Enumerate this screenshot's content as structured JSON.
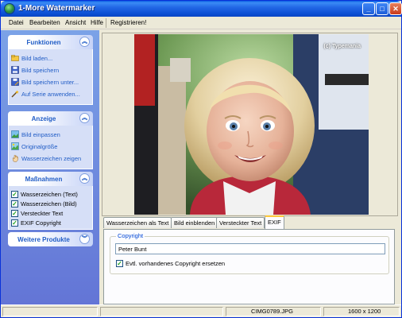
{
  "window": {
    "title": "1-More Watermarker"
  },
  "menu": [
    "Datei",
    "Bearbeiten",
    "Ansicht",
    "Hilfe",
    "Registrieren!"
  ],
  "sidebar": {
    "funktionen": {
      "title": "Funktionen",
      "items": [
        {
          "label": "Bild laden...",
          "icon": "open-folder-icon"
        },
        {
          "label": "Bild speichern",
          "icon": "floppy-disk-icon"
        },
        {
          "label": "Bild speichern unter...",
          "icon": "save-as-icon"
        },
        {
          "label": "Auf Serie anwenden...",
          "icon": "magic-wand-icon"
        }
      ]
    },
    "anzeige": {
      "title": "Anzeige",
      "items": [
        {
          "label": "Bild einpassen",
          "icon": "fit-image-icon"
        },
        {
          "label": "Originalgröße",
          "icon": "original-size-icon"
        },
        {
          "label": "Wasserzeichen zeigen",
          "icon": "hand-icon"
        }
      ]
    },
    "massnahmen": {
      "title": "Maßnahmen",
      "items": [
        {
          "label": "Wasserzeichen (Text)",
          "checked": true
        },
        {
          "label": "Wasserzeichen (Bild)",
          "checked": true
        },
        {
          "label": "Versteckter Text",
          "checked": true
        },
        {
          "label": "EXIF Copyright",
          "checked": true
        }
      ]
    },
    "weitere": {
      "title": "Weitere Produkte"
    }
  },
  "preview": {
    "watermark_text": "(c) Typemania"
  },
  "tabs": [
    "Wasserzeichen als Text",
    "Bild einblenden",
    "Versteckter Text",
    "EXIF"
  ],
  "active_tab": "EXIF",
  "exif": {
    "group_label": "Copyright",
    "copyright_value": "Peter Bunt",
    "overwrite_label": "Evtl. vorhandenes Copyright ersetzen",
    "overwrite_checked": true
  },
  "status": {
    "filename": "CIMG0789.JPG",
    "dimensions": "1600 x 1200"
  },
  "colors": {
    "title_bar": "#0a5ce3",
    "sidebar": "#7ba2e7",
    "link": "#215dc6"
  }
}
